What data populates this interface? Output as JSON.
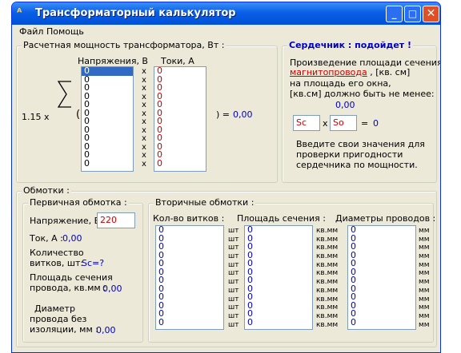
{
  "window": {
    "title": "Трансформаторный калькулятор",
    "minimize": "_",
    "maximize": "□",
    "close": "✕"
  },
  "menu": {
    "file": "Файл",
    "help": "Помощь"
  },
  "power": {
    "legend": "Расчетная мощность трансформатора, Вт :",
    "voltage_header": "Напряжения, В",
    "current_header": "Токи, А",
    "coef": "1.15  x",
    "paren_open": "(",
    "result_label": ") =",
    "result_value": "0,00",
    "x_mark": "x",
    "voltages": [
      "0",
      "0",
      "0",
      "0",
      "0",
      "0",
      "0",
      "0",
      "0",
      "0",
      "0",
      "0"
    ],
    "currents": [
      "0",
      "0",
      "0",
      "0",
      "0",
      "0",
      "0",
      "0",
      "0",
      "0",
      "0",
      "0"
    ]
  },
  "core": {
    "legend": "Сердечник : подойдет !",
    "line1": "Произведение площади сечения",
    "link": "магнитопровода",
    "line2_rest": " , [кв. см]",
    "line3": "на площадь его окна,",
    "line4": "[кв.см] должно быть не менее:",
    "min_value": "0,00",
    "sc": "Sc",
    "x_mark": "x",
    "so": "So",
    "eq": "=",
    "result": "0",
    "hint1": "Введите свои значения для",
    "hint2": "проверки пригодности",
    "hint3": "сердечника по мощности."
  },
  "windings": {
    "legend": "Обмотки :",
    "primary": {
      "legend": "Первичная обмотка :",
      "voltage_label": "Напряжение, В :",
      "voltage_value": "220",
      "current_label": "Ток, А :",
      "current_value": "0,00",
      "turns_label1": "Количество",
      "turns_label2": "витков, шт:",
      "turns_value": "Sc=?",
      "area_label1": "Площадь сечения",
      "area_label2": "провода, кв.мм :",
      "area_value": "0,00",
      "diam_label1": "Диаметр",
      "diam_label2": "провода без",
      "diam_label3": "изоляции, мм :",
      "diam_value": "0,00"
    },
    "secondary": {
      "legend": "Вторичные обмотки :",
      "turns_header": "Кол-во витков :",
      "area_header": "Площадь сечения :",
      "diam_header": "Диаметры проводов :",
      "unit_turns": "шт",
      "unit_area": "кв.мм",
      "unit_diam": "мм",
      "turns": [
        "0",
        "0",
        "0",
        "0",
        "0",
        "0",
        "0",
        "0",
        "0",
        "0",
        "0",
        "0"
      ],
      "areas": [
        "0",
        "0",
        "0",
        "0",
        "0",
        "0",
        "0",
        "0",
        "0",
        "0",
        "0",
        "0"
      ],
      "diams": [
        "0",
        "0",
        "0",
        "0",
        "0",
        "0",
        "0",
        "0",
        "0",
        "0",
        "0",
        "0"
      ]
    }
  }
}
